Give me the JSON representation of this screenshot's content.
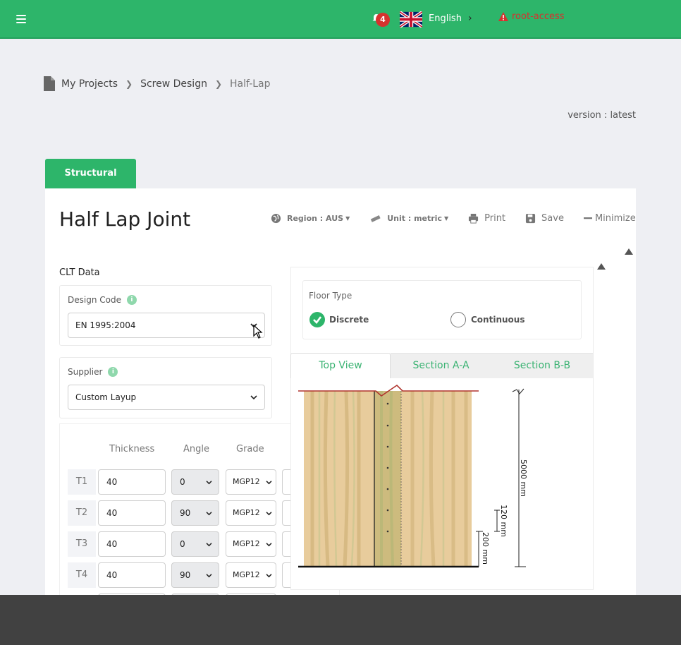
{
  "topbar": {
    "notifications_count": "4",
    "language": "English",
    "user": "root-access"
  },
  "breadcrumb": {
    "items": [
      "My Projects",
      "Screw Design",
      "Half-Lap"
    ]
  },
  "version": "version : latest",
  "tabs": {
    "structural": "Structural"
  },
  "page": {
    "title": "Half Lap Joint",
    "toolbar": {
      "region": "Region : AUS",
      "unit": "Unit : metric",
      "print": "Print",
      "save": "Save",
      "minimize": "Minimize"
    }
  },
  "clt": {
    "section_label": "CLT Data",
    "design_code": {
      "label": "Design Code",
      "value": "EN 1995:2004"
    },
    "supplier": {
      "label": "Supplier",
      "value": "Custom Layup"
    },
    "columns": [
      "Thickness",
      "Angle",
      "Grade"
    ],
    "layers": [
      {
        "name": "T1",
        "thickness": "40",
        "angle": "0",
        "grade": "MGP12"
      },
      {
        "name": "T2",
        "thickness": "40",
        "angle": "90",
        "grade": "MGP12"
      },
      {
        "name": "T3",
        "thickness": "40",
        "angle": "0",
        "grade": "MGP12"
      },
      {
        "name": "T4",
        "thickness": "40",
        "angle": "90",
        "grade": "MGP12"
      }
    ]
  },
  "floor_type": {
    "label": "Floor Type",
    "options": [
      "Discrete",
      "Continuous"
    ],
    "selected": "Discrete"
  },
  "views": {
    "tabs": [
      "Top View",
      "Section A-A",
      "Section B-B"
    ],
    "active": "Top View"
  },
  "drawing": {
    "dim_total": "5000 mm",
    "dim_spacing": "120 mm",
    "dim_edge": "200 mm"
  },
  "colors": {
    "brand": "#2db56a",
    "danger": "#d6322e",
    "wood": "#e8cc9c",
    "wood_lap": "#cdbb7e"
  }
}
